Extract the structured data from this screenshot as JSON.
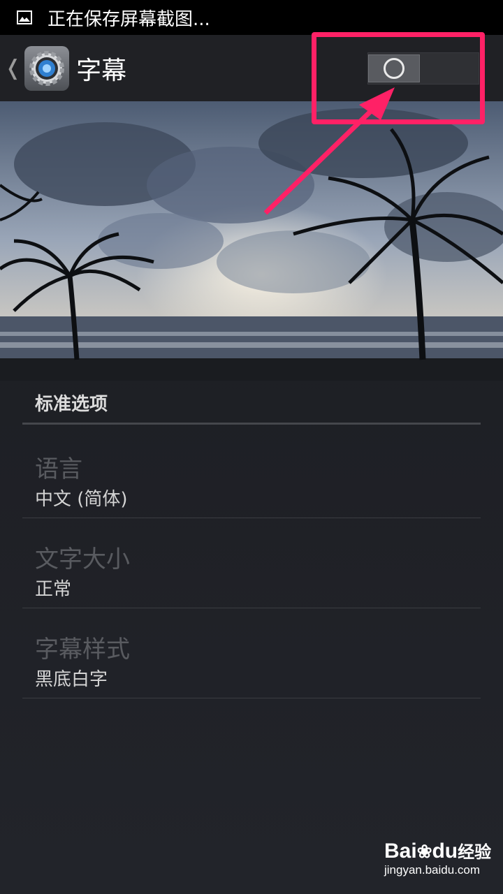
{
  "status_bar": {
    "text": "正在保存屏幕截图..."
  },
  "action_bar": {
    "back": "❬",
    "title": "字幕",
    "toggle_state": "off"
  },
  "section": {
    "header": "标准选项"
  },
  "preferences": [
    {
      "title": "语言",
      "summary": "中文 (简体)"
    },
    {
      "title": "文字大小",
      "summary": "正常"
    },
    {
      "title": "字幕样式",
      "summary": "黑底白字"
    }
  ],
  "watermark": {
    "brand_left": "Bai",
    "brand_mid": "du",
    "brand_cn": "经验",
    "url": "jingyan.baidu.com"
  },
  "colors": {
    "highlight": "#ff2166",
    "background": "#1b1c21"
  }
}
